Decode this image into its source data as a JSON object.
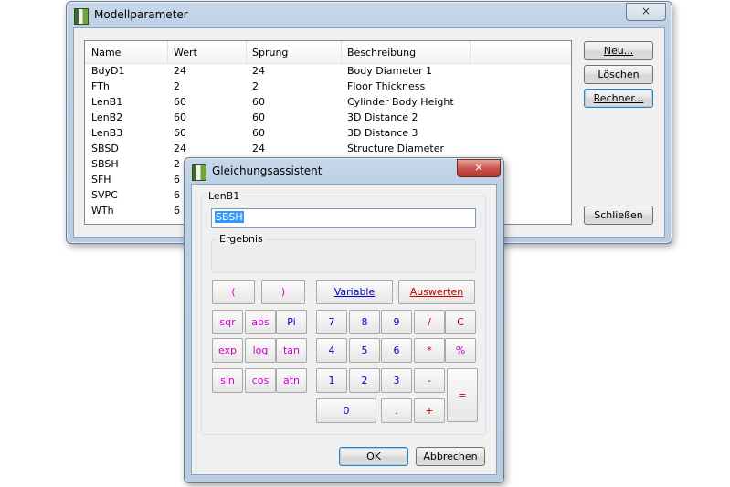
{
  "main_window": {
    "title": "Modellparameter",
    "close_glyph": "×",
    "columns": [
      "Name",
      "Wert",
      "Sprung",
      "Beschreibung"
    ],
    "rows": [
      {
        "name": "BdyD1",
        "wert": "24",
        "sprung": "24",
        "beschreibung": "Body Diameter 1"
      },
      {
        "name": "FTh",
        "wert": "2",
        "sprung": "2",
        "beschreibung": "Floor Thickness"
      },
      {
        "name": "LenB1",
        "wert": "60",
        "sprung": "60",
        "beschreibung": "Cylinder Body Height"
      },
      {
        "name": "LenB2",
        "wert": "60",
        "sprung": "60",
        "beschreibung": "3D Distance 2"
      },
      {
        "name": "LenB3",
        "wert": "60",
        "sprung": "60",
        "beschreibung": "3D Distance 3"
      },
      {
        "name": "SBSD",
        "wert": "24",
        "sprung": "24",
        "beschreibung": "Structure Diameter"
      },
      {
        "name": "SBSH",
        "wert": "2",
        "sprung": "",
        "beschreibung": ""
      },
      {
        "name": "SFH",
        "wert": "6",
        "sprung": "",
        "beschreibung": ""
      },
      {
        "name": "SVPC",
        "wert": "6",
        "sprung": "",
        "beschreibung": ""
      },
      {
        "name": "WTh",
        "wert": "6",
        "sprung": "",
        "beschreibung": ""
      }
    ],
    "buttons": {
      "neu": "Neu...",
      "loeschen": "Löschen",
      "rechner": "Rechner...",
      "schliessen": "Schließen"
    }
  },
  "calc_window": {
    "title": "Gleichungsassistent",
    "close_glyph": "×",
    "variable_group_label": "LenB1",
    "expression_value": "SBSH",
    "result_group_label": "Ergebnis",
    "result_value": "",
    "keys": {
      "open_paren": "(",
      "close_paren": ")",
      "variable": "Variable",
      "auswerten": "Auswerten",
      "sqr": "sqr",
      "abs": "abs",
      "pi": "Pi",
      "exp": "exp",
      "log": "log",
      "tan": "tan",
      "sin": "sin",
      "cos": "cos",
      "atn": "atn",
      "d7": "7",
      "d8": "8",
      "d9": "9",
      "d4": "4",
      "d5": "5",
      "d6": "6",
      "d1": "1",
      "d2": "2",
      "d3": "3",
      "d0": "0",
      "dot": ".",
      "div": "/",
      "mul": "*",
      "minus": "-",
      "plus": "+",
      "clear": "C",
      "percent": "%",
      "equals": "="
    },
    "ok": "OK",
    "abbrechen": "Abbrechen"
  }
}
